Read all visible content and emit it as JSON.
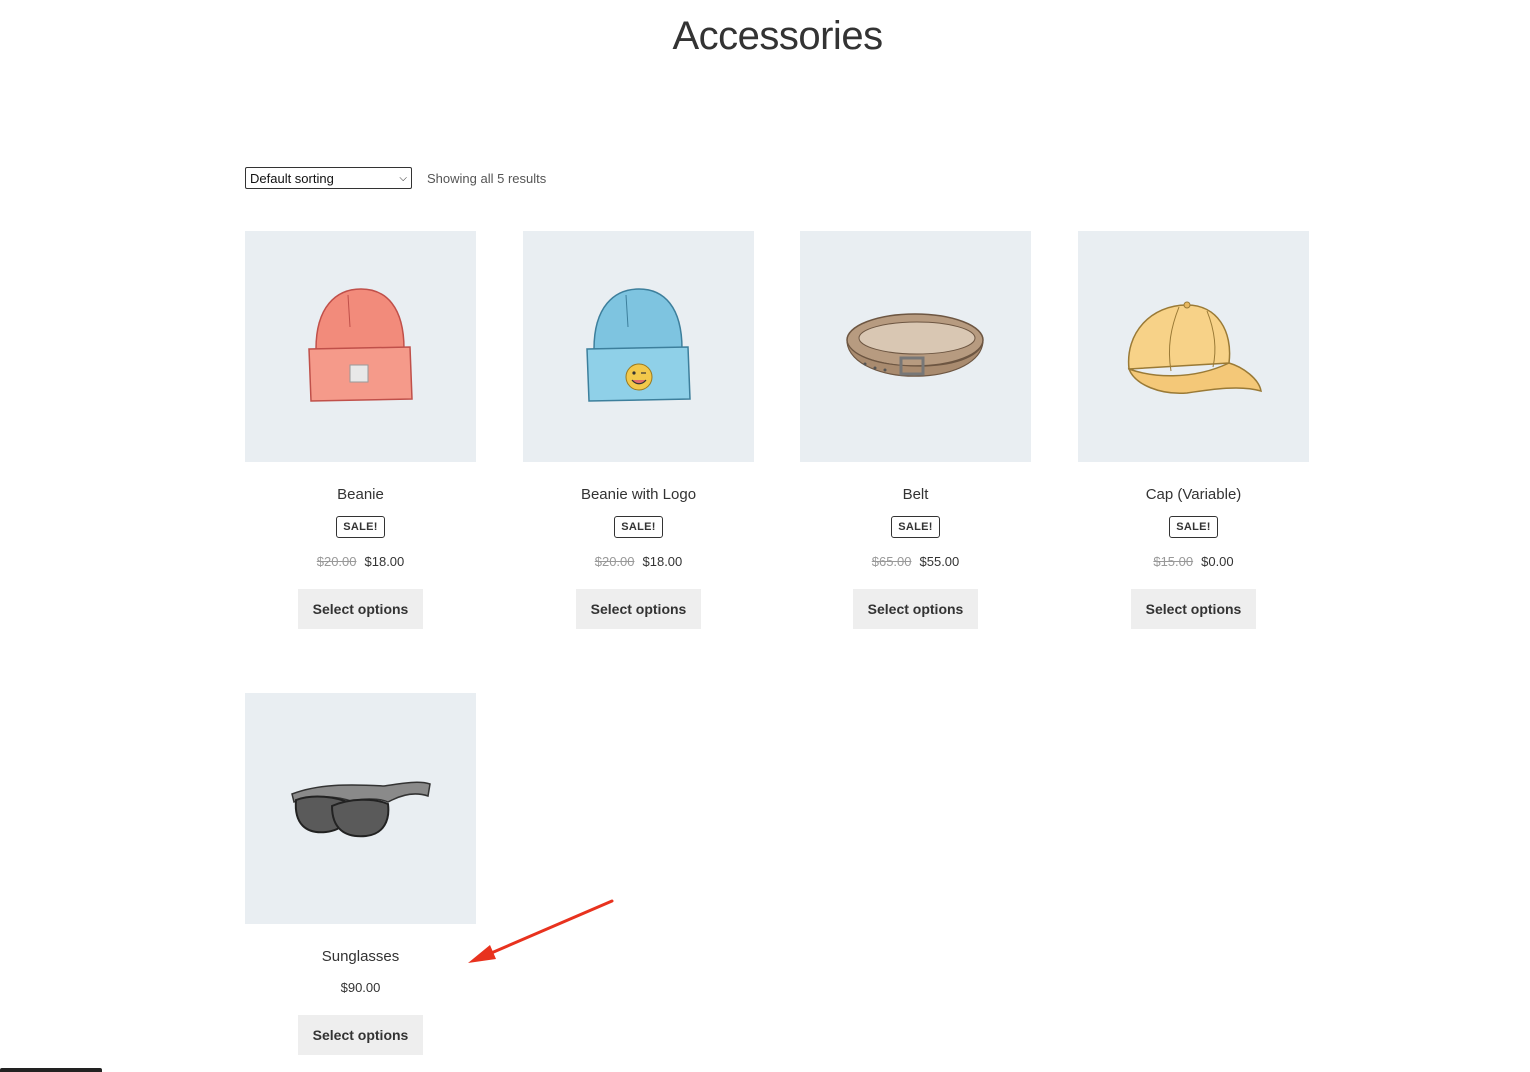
{
  "page": {
    "title": "Accessories"
  },
  "toolbar": {
    "sort_selected": "Default sorting",
    "result_count": "Showing all 5 results"
  },
  "products": [
    {
      "name": "Beanie",
      "badge": "SALE!",
      "old_price": "$20.00",
      "price": "$18.00",
      "button": "Select options",
      "image_icon": "beanie-icon"
    },
    {
      "name": "Beanie with Logo",
      "badge": "SALE!",
      "old_price": "$20.00",
      "price": "$18.00",
      "button": "Select options",
      "image_icon": "beanie-logo-icon"
    },
    {
      "name": "Belt",
      "badge": "SALE!",
      "old_price": "$65.00",
      "price": "$55.00",
      "button": "Select options",
      "image_icon": "belt-icon"
    },
    {
      "name": "Cap (Variable)",
      "badge": "SALE!",
      "old_price": "$15.00",
      "price": "$0.00",
      "button": "Select options",
      "image_icon": "cap-icon"
    },
    {
      "name": "Sunglasses",
      "price": "$90.00",
      "button": "Select options",
      "image_icon": "sunglasses-icon"
    }
  ],
  "colors": {
    "thumb_bg": "#e9eef2",
    "button_bg": "#eeeeee",
    "annotation_arrow": "#e8321e"
  }
}
